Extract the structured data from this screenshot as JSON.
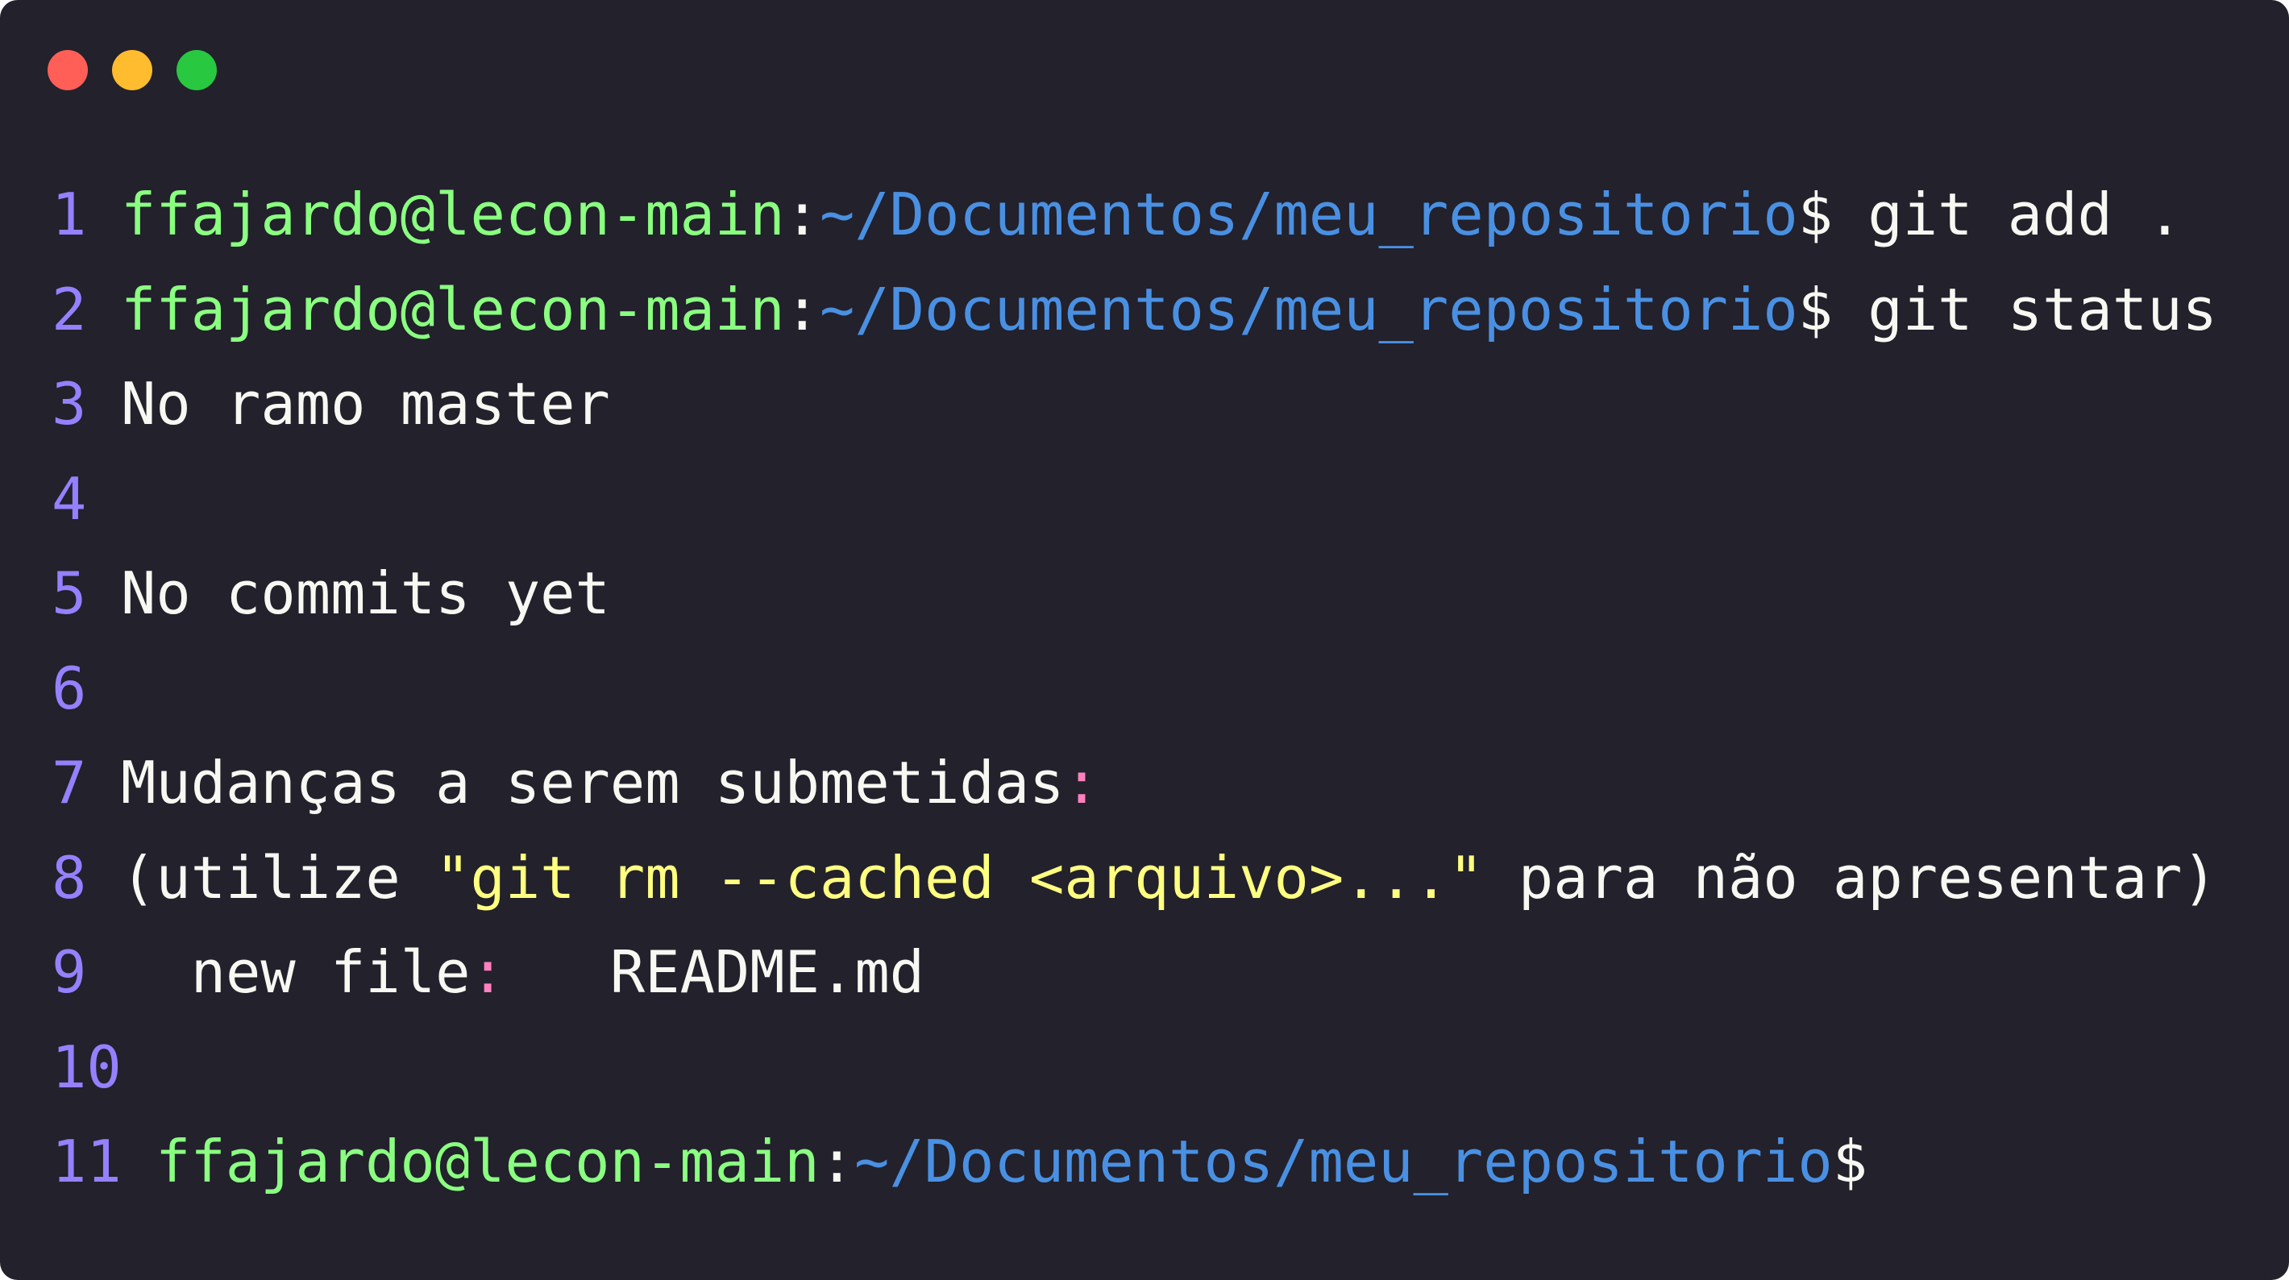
{
  "colors": {
    "background": "#22212c",
    "line_number": "#9580ff",
    "user_host": "#8aff80",
    "path": "#4a90e2",
    "text": "#f8f8f2",
    "colon_pink": "#ff80bf",
    "string_yellow": "#ffff80",
    "close_dot": "#ff5f57",
    "minimize_dot": "#febc2e",
    "maximize_dot": "#28c840"
  },
  "window_controls": [
    "close-dot",
    "minimize-dot",
    "maximize-dot"
  ],
  "lines": [
    {
      "n": "1",
      "user": "ffajardo@lecon-main",
      "sep": ":",
      "path": "~/Documentos/meu_repositorio",
      "prompt": "$",
      "cmd": " git add ."
    },
    {
      "n": "2",
      "user": "ffajardo@lecon-main",
      "sep": ":",
      "path": "~/Documentos/meu_repositorio",
      "prompt": "$",
      "cmd": " git status"
    },
    {
      "n": "3",
      "text": "No ramo master"
    },
    {
      "n": "4",
      "text": ""
    },
    {
      "n": "5",
      "text": "No commits yet"
    },
    {
      "n": "6",
      "text": ""
    },
    {
      "n": "7",
      "text": "Mudanças a serem submetidas",
      "colon": ":"
    },
    {
      "n": "8",
      "open": "(utilize ",
      "quoted": "\"git rm --cached <arquivo>...\"",
      "rest": " para não apresentar)"
    },
    {
      "n": "9",
      "label": "  new file",
      "colon": ":",
      "file": "   README.md"
    },
    {
      "n": "10",
      "text": ""
    },
    {
      "n": "11",
      "user": "ffajardo@lecon-main",
      "sep": ":",
      "path": "~/Documentos/meu_repositorio",
      "prompt": "$"
    }
  ]
}
